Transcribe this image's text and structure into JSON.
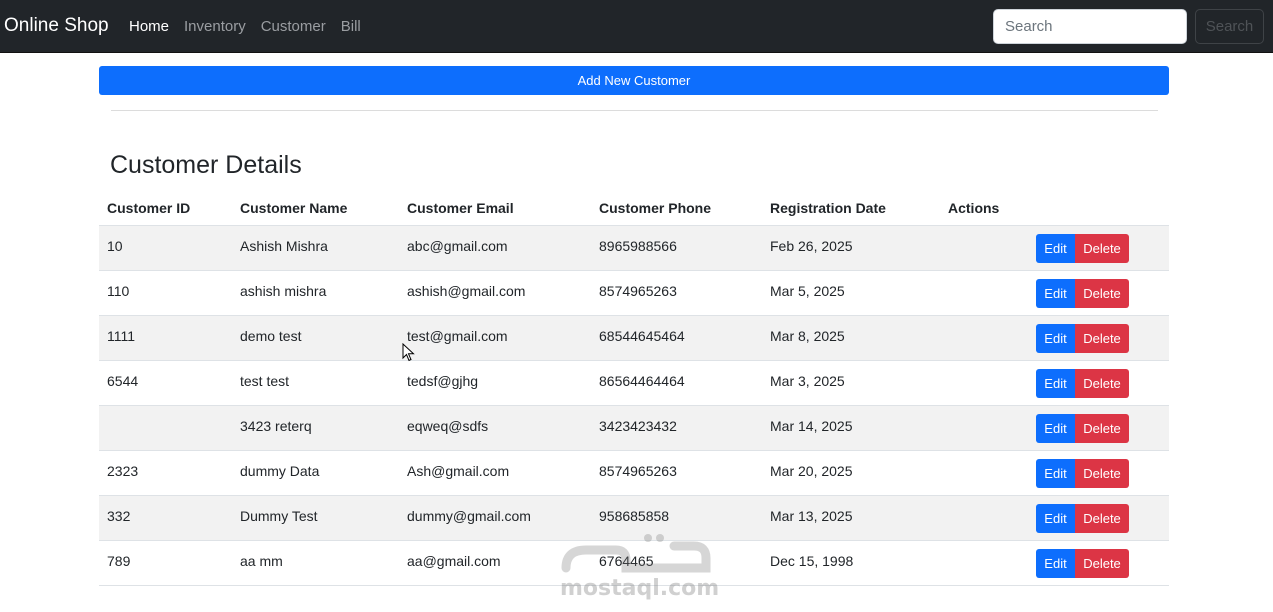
{
  "navbar": {
    "brand": "Online Shop",
    "links": [
      {
        "label": "Home"
      },
      {
        "label": "Inventory"
      },
      {
        "label": "Customer"
      },
      {
        "label": "Bill"
      }
    ],
    "search_placeholder": "Search",
    "search_button": "Search"
  },
  "actions": {
    "add_label": "Add New Customer"
  },
  "page_title": "Customer Details",
  "table": {
    "headers": [
      "Customer ID",
      "Customer Name",
      "Customer Email",
      "Customer Phone",
      "Registration Date",
      "Actions"
    ],
    "rows": [
      {
        "id": "10",
        "name": "Ashish Mishra",
        "email": "abc@gmail.com",
        "phone": "8965988566",
        "date": "Feb 26, 2025"
      },
      {
        "id": "110",
        "name": "ashish mishra",
        "email": "ashish@gmail.com",
        "phone": "8574965263",
        "date": "Mar 5, 2025"
      },
      {
        "id": "1111",
        "name": "demo test",
        "email": "test@gmail.com",
        "phone": "68544645464",
        "date": "Mar 8, 2025"
      },
      {
        "id": "6544",
        "name": "test test",
        "email": "tedsf@gjhg",
        "phone": "86564464464",
        "date": "Mar 3, 2025"
      },
      {
        "id": "",
        "name": "3423 reterq",
        "email": "eqweq@sdfs",
        "phone": "3423423432",
        "date": "Mar 14, 2025"
      },
      {
        "id": "2323",
        "name": "dummy Data",
        "email": "Ash@gmail.com",
        "phone": "8574965263",
        "date": "Mar 20, 2025"
      },
      {
        "id": "332",
        "name": "Dummy Test",
        "email": "dummy@gmail.com",
        "phone": "958685858",
        "date": "Mar 13, 2025"
      },
      {
        "id": "789",
        "name": "aa mm",
        "email": "aa@gmail.com",
        "phone": "6764465",
        "date": "Dec 15, 1998"
      }
    ],
    "edit_label": "Edit",
    "delete_label": "Delete"
  },
  "watermark": {
    "text": "mostaql.com"
  },
  "colors": {
    "navbar_bg": "#212529",
    "primary": "#0d6efd",
    "danger": "#dc3545",
    "stripe": "#f2f2f2"
  }
}
